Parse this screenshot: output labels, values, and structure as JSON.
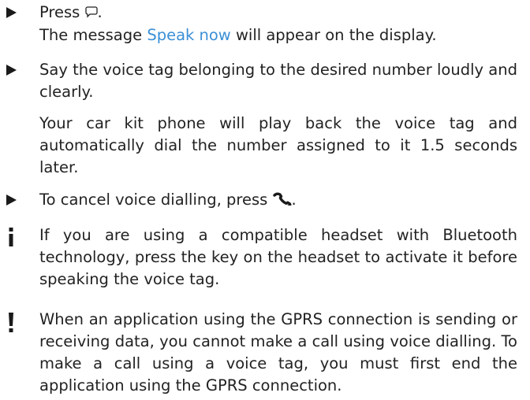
{
  "instructions": [
    {
      "prefix": "Press ",
      "icon": "voice-key-icon",
      "suffix": ".",
      "line2_before": "The message ",
      "line2_link": "Speak now",
      "line2_after": " will appear on the display."
    },
    {
      "text": "Say the voice tag belonging to the desired number loudly and clearly.",
      "followup": "Your car kit phone will play back the voice tag and automatically dial the number assigned to it 1.5 seconds later."
    },
    {
      "prefix": "To cancel voice dialling, press ",
      "icon": "end-call-icon",
      "suffix": "."
    }
  ],
  "info_note": {
    "icon": "info-icon",
    "text": "If you are using a compatible headset with Bluetooth technology, press the key on the headset to activate it before speaking the voice tag."
  },
  "warning_note": {
    "icon": "warning-icon",
    "text": "When an application using the GPRS connection is sending or receiving data, you cannot make a call using voice dialling. To make a call using a voice tag, you must first end the application using the GPRS connection."
  },
  "colors": {
    "text": "#222222",
    "link": "#3b8fd6",
    "bullet": "#1a1a1a"
  }
}
